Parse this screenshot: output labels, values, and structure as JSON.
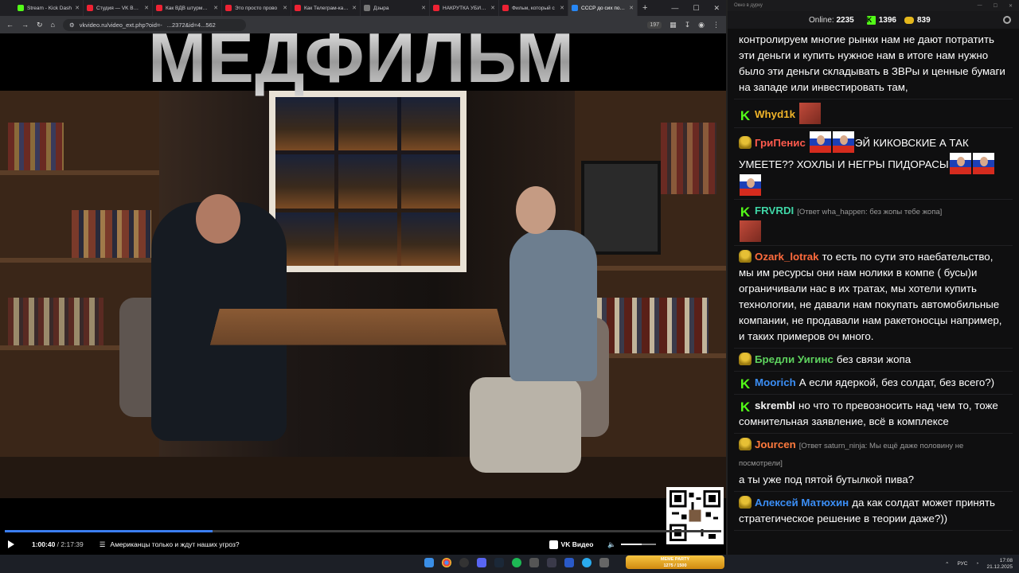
{
  "browser": {
    "tabs": [
      {
        "label": "Stream - Kick Dash",
        "color": "#53fc18",
        "active": false
      },
      {
        "label": "Студия — VK Видео",
        "color": "#e23",
        "active": false
      },
      {
        "label": "Как ВДВ штурмуют",
        "color": "#e23",
        "active": false
      },
      {
        "label": "Это просто прово",
        "color": "#e23",
        "active": false
      },
      {
        "label": "Как Телеграм-кана",
        "color": "#e23",
        "active": false
      },
      {
        "label": "Дзыра",
        "color": "#777",
        "active": false
      },
      {
        "label": "НАКРУТКА УБИВА",
        "color": "#e23",
        "active": false
      },
      {
        "label": "Фильм, который с",
        "color": "#e23",
        "active": false
      },
      {
        "label": "СССР до сих пор с",
        "color": "#2787f5",
        "active": true
      }
    ],
    "new_tab": "+",
    "url_short": "vkvideo.ru/video_ext.php?oid=-",
    "url_tail": "...2372&id=4...562",
    "ext_badge": "197"
  },
  "video": {
    "overlay_title": "МЕДФИЛЬМ",
    "progress": 0.29,
    "time_current": "1:00:40",
    "time_total": "2:17:39",
    "chapter": "Американцы только и ждут наших угроз?",
    "brand": "VK Видео"
  },
  "chat": {
    "window_title": "Окно в дурку",
    "online_label": "Online:",
    "online_count": "2235",
    "kick_count": "1396",
    "gold_count": "839",
    "messages": [
      {
        "nick": "",
        "color": "#fff",
        "badge": "",
        "text": "контролируем многие рынки нам не дают потратить эти деньги и купить нужное нам в итоге нам нужно было эти деньги складывать в ЗВРы и ценные бумаги на западе или инвестировать там,",
        "reply": "",
        "emotes_before": 0,
        "emotes_after": 0
      },
      {
        "nick": "Whyd1k",
        "color": "#f0b429",
        "badge": "k",
        "text": "",
        "reply": "",
        "emotes_before": 0,
        "emotes_after": 1
      },
      {
        "nick": "ГриПенис",
        "color": "#ff5a4d",
        "badge": "f",
        "text": "ЭЙ КИКОВСКИЕ А ТАК УМЕЕТЕ?? ХОХЛЫ И НЕГРЫ ПИДОРАСЫ",
        "reply": "",
        "emotes_before": 2,
        "emotes_after": 3
      },
      {
        "nick": "FRVRDI",
        "color": "#3fd6a6",
        "badge": "k",
        "text": "",
        "reply": "[Ответ wha_happen: без жопы тебе жопа]",
        "emotes_before": 0,
        "emotes_after": 1
      },
      {
        "nick": "Ozark_lotrak",
        "color": "#ff6b3d",
        "badge": "f",
        "text": "то есть по сути это наебательство, мы им ресурсы они нам нолики в компе ( бусы)и ограничивали нас в их тратах, мы хотели купить технологии, не давали нам покупать автомобильные компании, не продавали нам ракетоносцы например, и таких примеров оч много.",
        "reply": "",
        "emotes_before": 0,
        "emotes_after": 0
      },
      {
        "nick": "Бредли Уигинс",
        "color": "#5ed35e",
        "badge": "f",
        "text": "без связи жопа",
        "reply": "",
        "emotes_before": 0,
        "emotes_after": 0
      },
      {
        "nick": "Moorich",
        "color": "#3b8ef5",
        "badge": "k",
        "text": "А если ядеркой, без солдат, без всего?)",
        "reply": "",
        "emotes_before": 0,
        "emotes_after": 0
      },
      {
        "nick": "skrembl",
        "color": "#f5f5f5",
        "badge": "k",
        "text": "но что то превозносить над чем то, тоже сомнительная заявление, всё в комплексе",
        "reply": "",
        "emotes_before": 0,
        "emotes_after": 0
      },
      {
        "nick": "Jourcen",
        "color": "#ff7a3d",
        "badge": "f",
        "text": "а ты уже под пятой бутылкой пива?",
        "reply": "[Ответ saturn_ninja: Мы ещё даже половину не посмотрели]",
        "emotes_before": 0,
        "emotes_after": 0
      },
      {
        "nick": "Алексей Матюхин",
        "color": "#3b8ef5",
        "badge": "f",
        "text": "да как солдат может принять стратегическое решение в теории даже?))",
        "reply": "",
        "emotes_before": 0,
        "emotes_after": 0
      }
    ]
  },
  "taskbar": {
    "meme_party_title": "MEME PARTY",
    "meme_party_progress": "1275 / 1500",
    "lang": "РУС",
    "time": "17:08",
    "date": "21.12.2025"
  }
}
